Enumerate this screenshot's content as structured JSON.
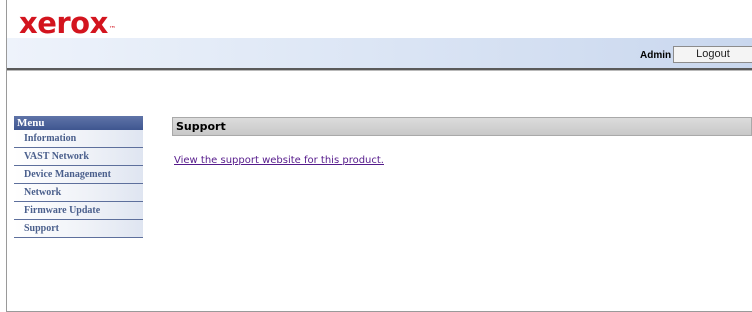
{
  "header": {
    "logo_text": "xerox",
    "logo_tm": "™",
    "brand_color": "#d3141e",
    "admin_label": "Admin",
    "logout_label": "Logout"
  },
  "menu": {
    "title": "Menu",
    "items": [
      {
        "label": "Information"
      },
      {
        "label": "VAST Network"
      },
      {
        "label": "Device Management"
      },
      {
        "label": "Network"
      },
      {
        "label": "Firmware Update"
      },
      {
        "label": "Support"
      }
    ]
  },
  "main": {
    "section_title": "Support",
    "link_text": "View the support website for this product."
  }
}
